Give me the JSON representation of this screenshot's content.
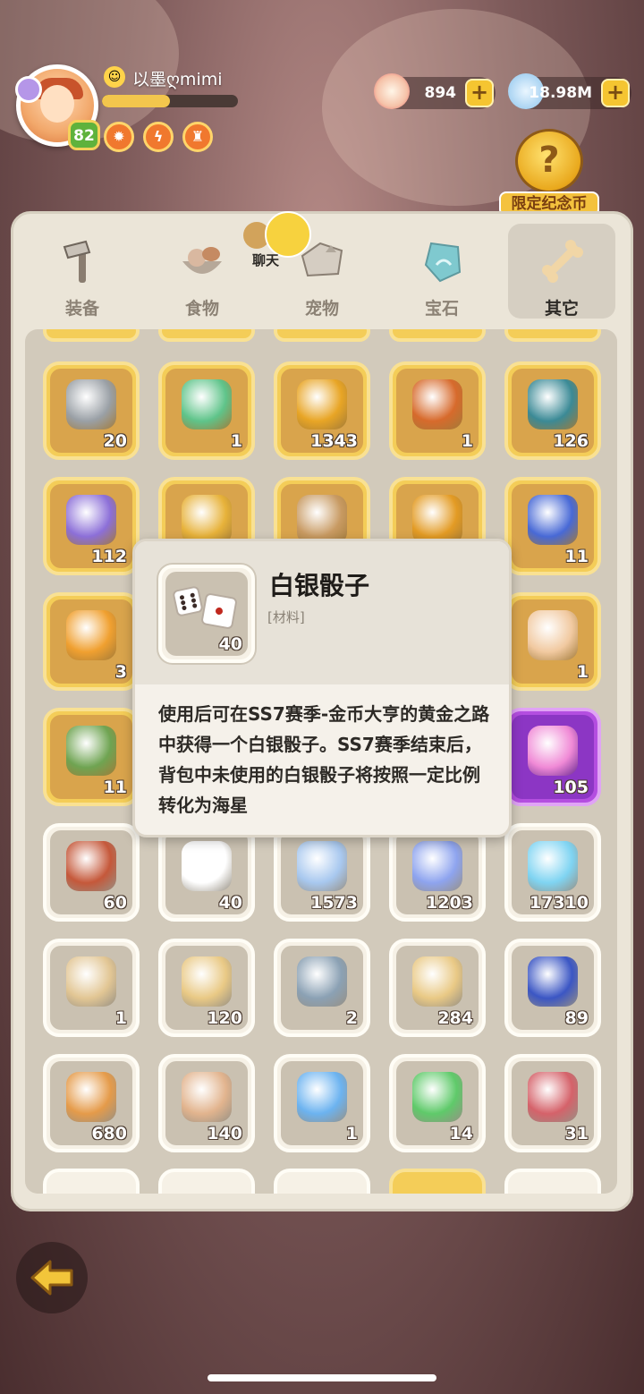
{
  "player": {
    "name": "以墨ღmimi",
    "level": "82",
    "exp_fraction": 0.5,
    "badges": [
      "flame-badge",
      "lightning-badge",
      "shield-badge"
    ]
  },
  "currencies": [
    {
      "icon": "shell-starfish-icon",
      "value": "894"
    },
    {
      "icon": "pearl-icon",
      "value": "18.98M"
    }
  ],
  "plus_label": "+",
  "limited_coin": {
    "label": "限定纪念币",
    "symbol": "?"
  },
  "chat": {
    "label": "聊天"
  },
  "tabs": [
    {
      "label": "装备",
      "icon": "hammer-icon",
      "active": false
    },
    {
      "label": "食物",
      "icon": "food-bowl-icon",
      "active": false
    },
    {
      "label": "宠物",
      "icon": "pet-skull-icon",
      "active": false
    },
    {
      "label": "宝石",
      "icon": "gem-icon",
      "active": false
    },
    {
      "label": "其它",
      "icon": "bone-icon",
      "active": true
    }
  ],
  "popup": {
    "title": "白银骰子",
    "type": "[材料]",
    "count": "40",
    "description": "使用后可在SS7赛季-金币大亨的黄金之路中获得一个白银骰子。SS7赛季结束后，背包中未使用的白银骰子将按照一定比例转化为海星"
  },
  "items": [
    [
      {
        "name": "magnifier",
        "count": "20",
        "style": "gold",
        "color": "#9aa0a6"
      },
      {
        "name": "gem-sack",
        "count": "1",
        "style": "gold",
        "color": "#5fc48a"
      },
      {
        "name": "gold-coin",
        "count": "1343",
        "style": "gold",
        "color": "#e8a525"
      },
      {
        "name": "rocket-card",
        "count": "1",
        "style": "gold",
        "color": "#d76a2c"
      },
      {
        "name": "carrot-sack",
        "count": "126",
        "style": "gold",
        "color": "#3b8a96"
      }
    ],
    [
      {
        "name": "purple-sack",
        "count": "112",
        "style": "gold",
        "color": "#8c6fd8"
      },
      {
        "name": "helmet",
        "count": "",
        "style": "gold",
        "color": "#e7b23a"
      },
      {
        "name": "horn-crest",
        "count": "",
        "style": "gold",
        "color": "#c89a62"
      },
      {
        "name": "swirl-coin",
        "count": "",
        "style": "gold",
        "color": "#e39b24"
      },
      {
        "name": "paw-shield",
        "count": "11",
        "style": "gold",
        "color": "#4869d6"
      }
    ],
    [
      {
        "name": "swirl-sack",
        "count": "3",
        "style": "gold",
        "color": "#f0a030"
      },
      {
        "name": "hidden-2",
        "count": "",
        "style": "gold",
        "color": "#d9a44c"
      },
      {
        "name": "hidden-3",
        "count": "",
        "style": "gold",
        "color": "#d9a44c"
      },
      {
        "name": "hidden-4",
        "count": "",
        "style": "gold",
        "color": "#d9a44c"
      },
      {
        "name": "caveman-face",
        "count": "1",
        "style": "gold",
        "color": "#f1c9a0"
      }
    ],
    [
      {
        "name": "stone-statue",
        "count": "11",
        "style": "gold",
        "color": "#6fa452"
      },
      {
        "name": "hidden-6",
        "count": "",
        "style": "gold",
        "color": "#d9a44c"
      },
      {
        "name": "hidden-7",
        "count": "",
        "style": "gold",
        "color": "#d9a44c"
      },
      {
        "name": "hidden-8",
        "count": "",
        "style": "gold",
        "color": "#d9a44c"
      },
      {
        "name": "pink-crystal",
        "count": "105",
        "style": "purple",
        "color": "#f08ad6"
      }
    ],
    [
      {
        "name": "meat",
        "count": "60",
        "style": "grey",
        "color": "#c5583a"
      },
      {
        "name": "silver-dice",
        "count": "40",
        "style": "grey",
        "color": "#ffffff"
      },
      {
        "name": "moon-stone",
        "count": "1573",
        "style": "grey",
        "color": "#a8c8ef"
      },
      {
        "name": "star-stone",
        "count": "1203",
        "style": "grey",
        "color": "#8ea4ef"
      },
      {
        "name": "blue-crystal",
        "count": "17310",
        "style": "grey",
        "color": "#7fd4f2"
      }
    ],
    [
      {
        "name": "mystery-bone",
        "count": "1",
        "style": "grey",
        "color": "#e2c694"
      },
      {
        "name": "spotted-sack",
        "count": "120",
        "style": "grey",
        "color": "#e9c985"
      },
      {
        "name": "treasure-chest",
        "count": "2",
        "style": "grey",
        "color": "#8ba1b4"
      },
      {
        "name": "spotted-sack-2",
        "count": "284",
        "style": "grey",
        "color": "#e9c985"
      },
      {
        "name": "blue-rune",
        "count": "89",
        "style": "grey",
        "color": "#3b56c4"
      }
    ],
    [
      {
        "name": "orange-scroll",
        "count": "680",
        "style": "grey",
        "color": "#e59b4a"
      },
      {
        "name": "paw-scroll",
        "count": "140",
        "style": "grey",
        "color": "#e2b48e"
      },
      {
        "name": "blue-card",
        "count": "1",
        "style": "grey",
        "color": "#6cb3f0"
      },
      {
        "name": "green-card",
        "count": "14",
        "style": "grey",
        "color": "#5fca6a"
      },
      {
        "name": "red-card",
        "count": "31",
        "style": "grey",
        "color": "#d5626a"
      }
    ]
  ]
}
